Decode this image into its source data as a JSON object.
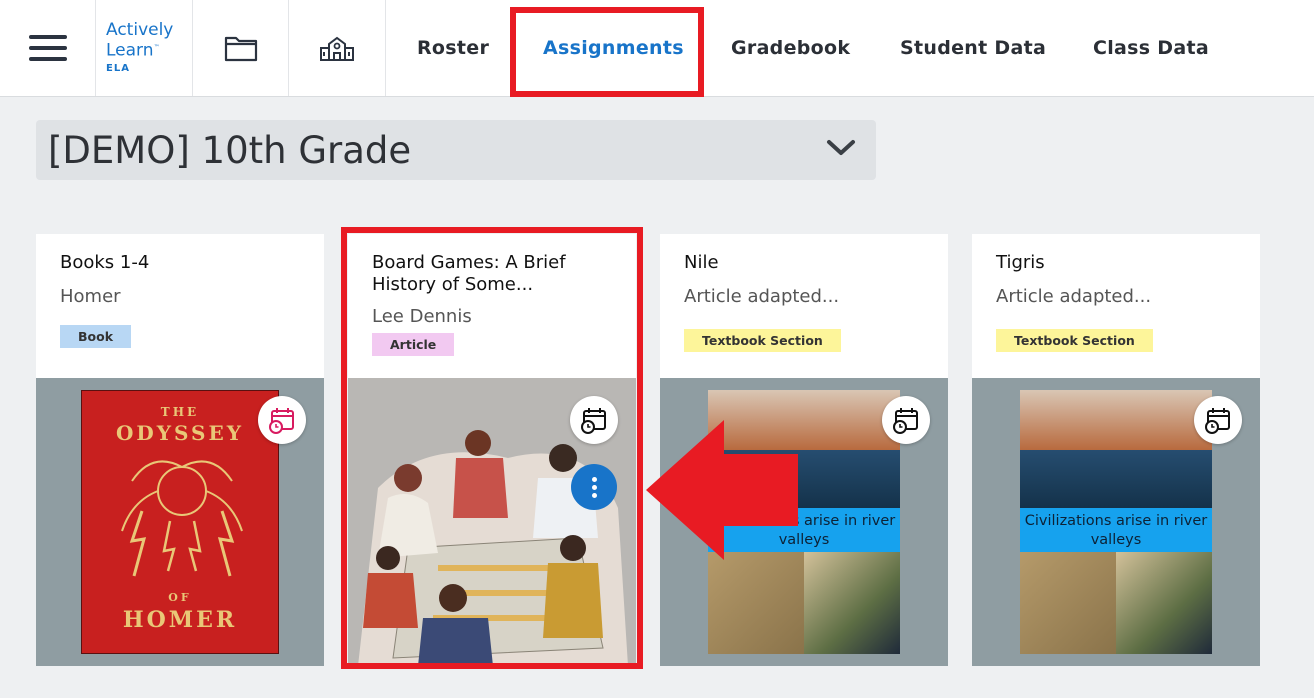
{
  "brand": {
    "name_line1": "Actively",
    "name_line2": "Learn",
    "trademark": "™",
    "product": "ELA"
  },
  "nav": {
    "tabs": [
      {
        "label": "Roster"
      },
      {
        "label": "Assignments"
      },
      {
        "label": "Gradebook"
      },
      {
        "label": "Student Data"
      },
      {
        "label": "Class Data"
      }
    ],
    "active_tab": "Assignments"
  },
  "class_selector": {
    "value": "[DEMO] 10th Grade"
  },
  "cards": [
    {
      "title": "Books 1-4",
      "author": "Homer",
      "badge": "Book",
      "cover": {
        "line1": "THE",
        "line2": "ODYSSEY",
        "line3": "OF",
        "line4": "HOMER"
      },
      "schedule_icon_color": "#d81b60"
    },
    {
      "title": "Board Games: A Brief History of Some...",
      "author": "Lee Dennis",
      "badge": "Article",
      "schedule_icon_color": "#111111"
    },
    {
      "title": "Nile",
      "author": "Article adapted...",
      "badge": "Textbook Section",
      "caption": "Civilizations arise in river valleys",
      "schedule_icon_color": "#111111"
    },
    {
      "title": "Tigris",
      "author": "Article adapted...",
      "badge": "Textbook Section",
      "caption": "Civilizations arise in river valleys",
      "schedule_icon_color": "#111111"
    }
  ],
  "colors": {
    "accent": "#1874c9",
    "highlight": "#e81b23",
    "book_badge": "#b8d7f4",
    "article_badge": "#f2c9f1",
    "textbook_badge": "#fdf59a"
  }
}
